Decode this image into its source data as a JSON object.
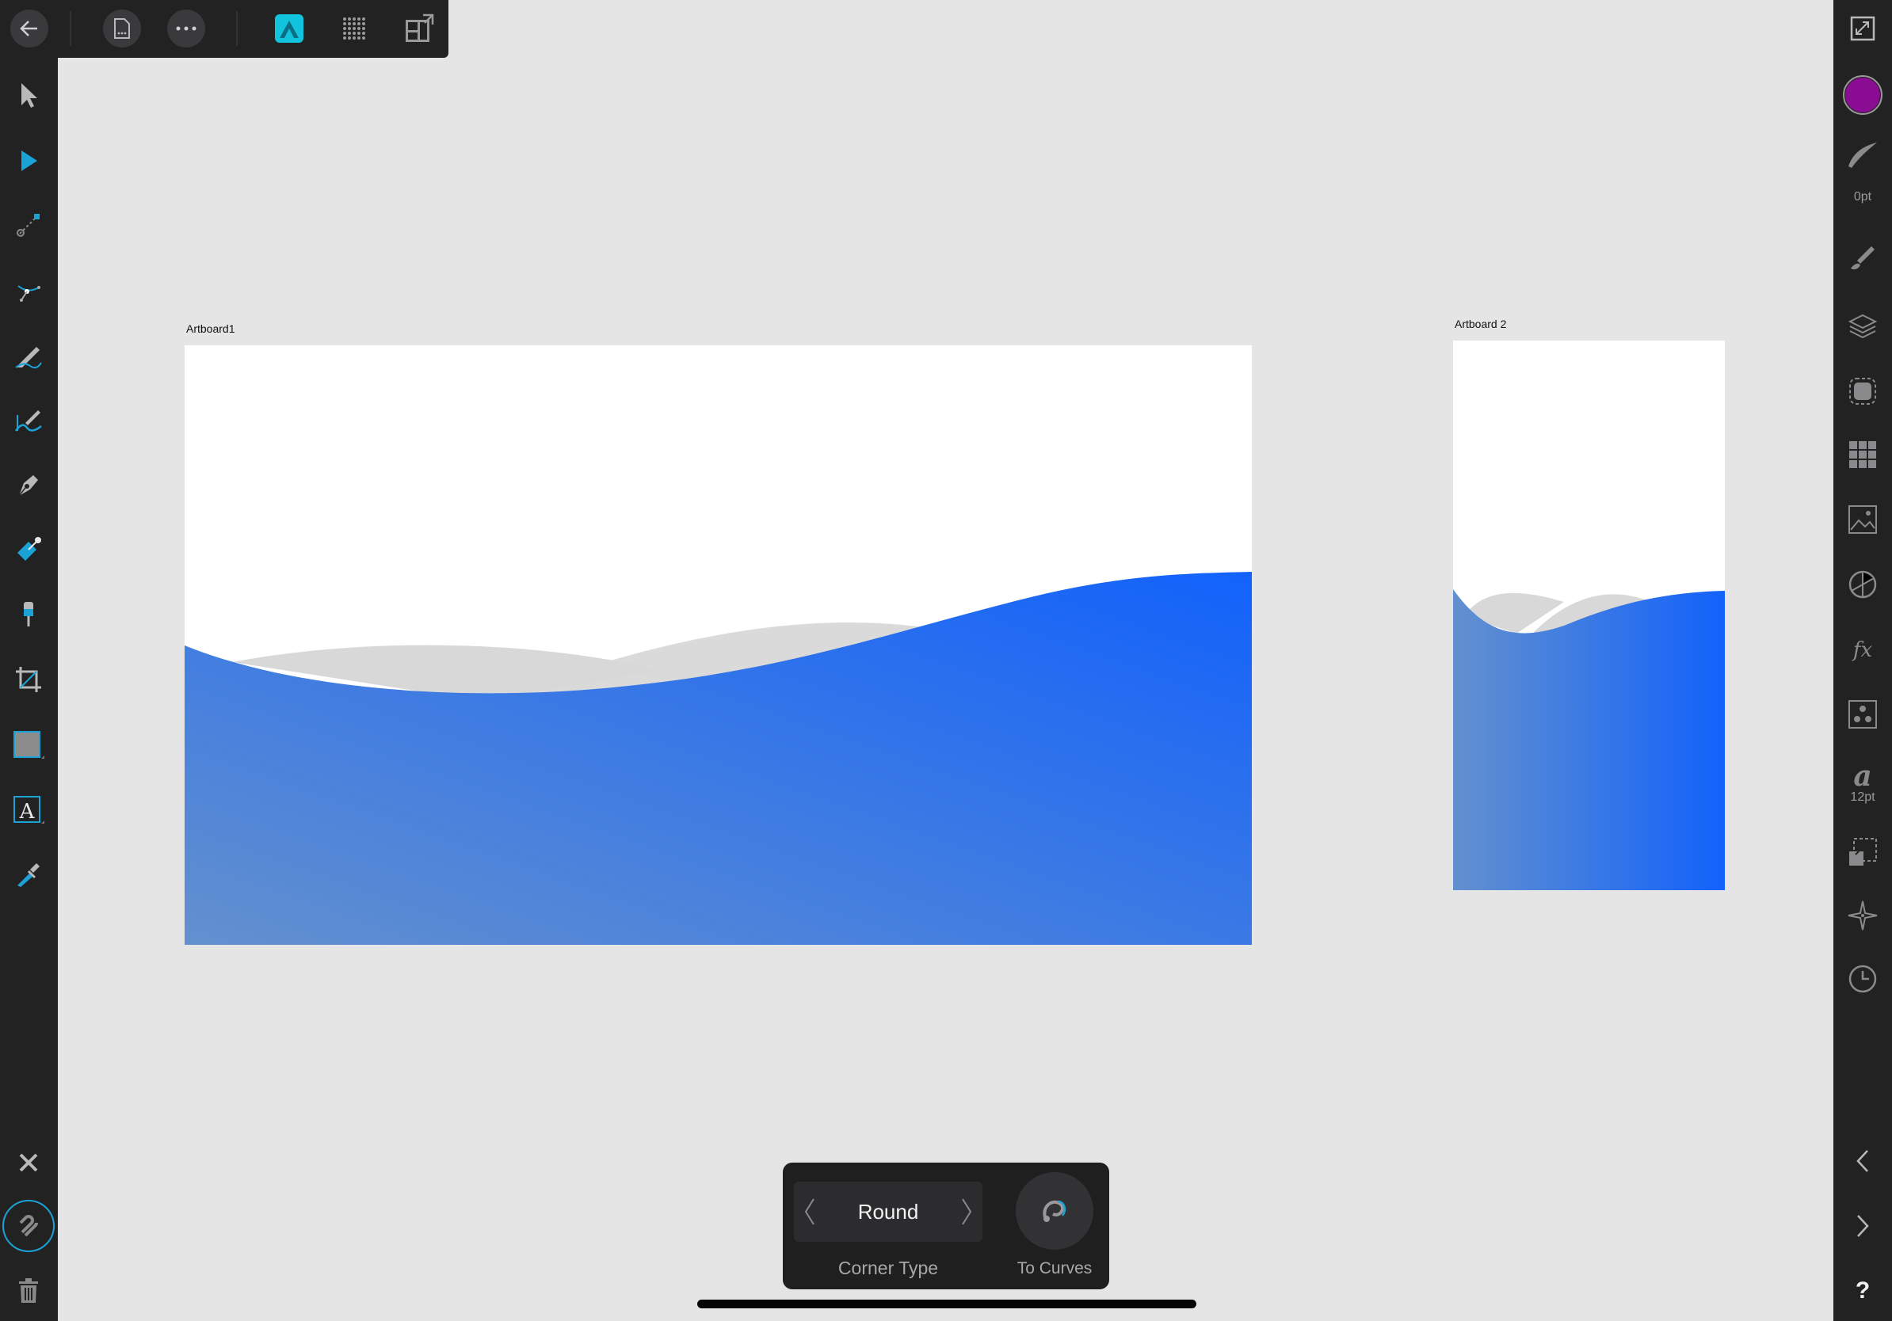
{
  "colors": {
    "chrome": "#222223",
    "canvas": "#e5e5e6",
    "accent": "#1ba3d8",
    "fill_swatch": "#8a0c93",
    "wave_blue_start": "#6390ce",
    "wave_blue_end": "#1262fb",
    "wave_grey": "#d9d9d9"
  },
  "top_bar": {
    "icons": [
      "back-arrow-icon",
      "document-icon",
      "more-icon",
      "designer-persona-icon",
      "pixel-persona-icon",
      "export-persona-icon"
    ]
  },
  "left_toolbar": {
    "tools": [
      "move-tool-icon",
      "node-tool-icon",
      "point-transform-tool-icon",
      "corner-tool-icon",
      "pencil-tool-icon",
      "vector-brush-tool-icon",
      "pen-tool-icon",
      "fill-tool-icon",
      "transparency-tool-icon",
      "artboard-tool-icon",
      "rectangle-tool-icon",
      "text-tool-icon",
      "color-picker-tool-icon"
    ],
    "bottom": [
      "close-icon",
      "snapping-magnet-icon",
      "trash-icon"
    ]
  },
  "right_panel": {
    "stroke_width": "0pt",
    "font_size": "12pt",
    "icons": [
      "fullscreen-icon",
      "fill-color-swatch",
      "stroke-icon",
      "brushes-icon",
      "layers-icon",
      "appearance-icon",
      "swatches-icon",
      "image-icon",
      "transform-icon",
      "fx-icon",
      "assets-icon",
      "text-style-icon",
      "styles-icon",
      "navigator-icon",
      "history-icon",
      "collapse-left-icon",
      "expand-right-icon",
      "help-icon"
    ],
    "help": "?"
  },
  "canvas": {
    "artboards": [
      {
        "label": "Artboard1"
      },
      {
        "label": "Artboard 2"
      }
    ]
  },
  "context_bar": {
    "corner_type_value": "Round",
    "corner_type_label": "Corner Type",
    "to_curves_label": "To Curves"
  }
}
